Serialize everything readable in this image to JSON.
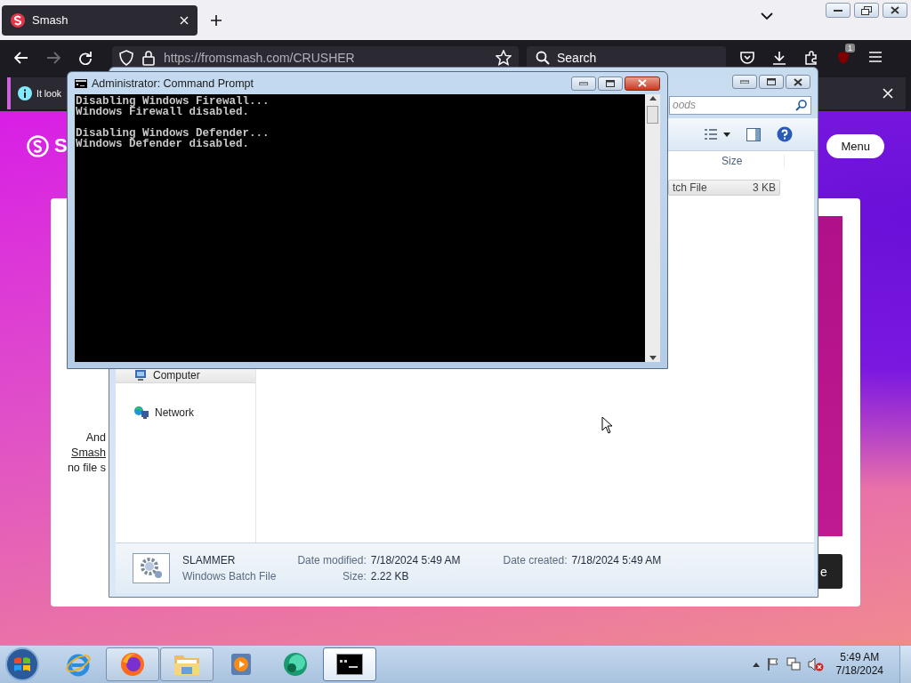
{
  "browser": {
    "tabs": [
      {
        "label": "Smash",
        "selected": true
      }
    ],
    "url": "https://fromsmash.com/CRUSHER",
    "search": {
      "placeholder": "Search"
    },
    "extension_badge": "1",
    "notification": "It look"
  },
  "page": {
    "logo_text": "S",
    "menu_button": "Menu",
    "card_lines": [
      {
        "text": "And",
        "kind": "plain"
      },
      {
        "text": "Smash",
        "kind": "link"
      },
      {
        "text": "no file s",
        "kind": "plain"
      }
    ],
    "button_text": "e"
  },
  "explorer": {
    "search": {
      "placeholder": "oods"
    },
    "columns": [
      {
        "label": "Size"
      }
    ],
    "rows": [
      {
        "type": "tch File",
        "size": "3 KB",
        "selected": true
      }
    ],
    "nav": [
      {
        "label": "Computer",
        "kind": "computer",
        "selected": true
      },
      {
        "label": "Network",
        "kind": "network",
        "selected": false
      }
    ],
    "details": {
      "name": "SLAMMER",
      "type": "Windows Batch File",
      "fields": [
        {
          "label": "Date modified:",
          "value": "7/18/2024 5:49 AM"
        },
        {
          "label": "Size:",
          "value": "2.22 KB"
        },
        {
          "label": "Date created:",
          "value": "7/18/2024 5:49 AM"
        }
      ]
    }
  },
  "cmd": {
    "title": "Administrator:  Command Prompt",
    "blocks": [
      {
        "lines": [
          "Disabling Windows Firewall...",
          "Windows Firewall disabled."
        ]
      },
      {
        "lines": [
          "Disabling Windows Defender...",
          "Windows Defender disabled."
        ]
      }
    ]
  },
  "taskbar": {
    "apps": [
      {
        "kind": "ie",
        "running": false,
        "selected": false
      },
      {
        "kind": "firefox",
        "running": true,
        "selected": false
      },
      {
        "kind": "explorer",
        "running": true,
        "selected": false
      },
      {
        "kind": "media",
        "running": false,
        "selected": false
      },
      {
        "kind": "app",
        "running": false,
        "selected": false
      },
      {
        "kind": "cmd",
        "running": true,
        "selected": true
      }
    ],
    "clock": {
      "time": "5:49 AM",
      "date": "7/18/2024"
    }
  }
}
